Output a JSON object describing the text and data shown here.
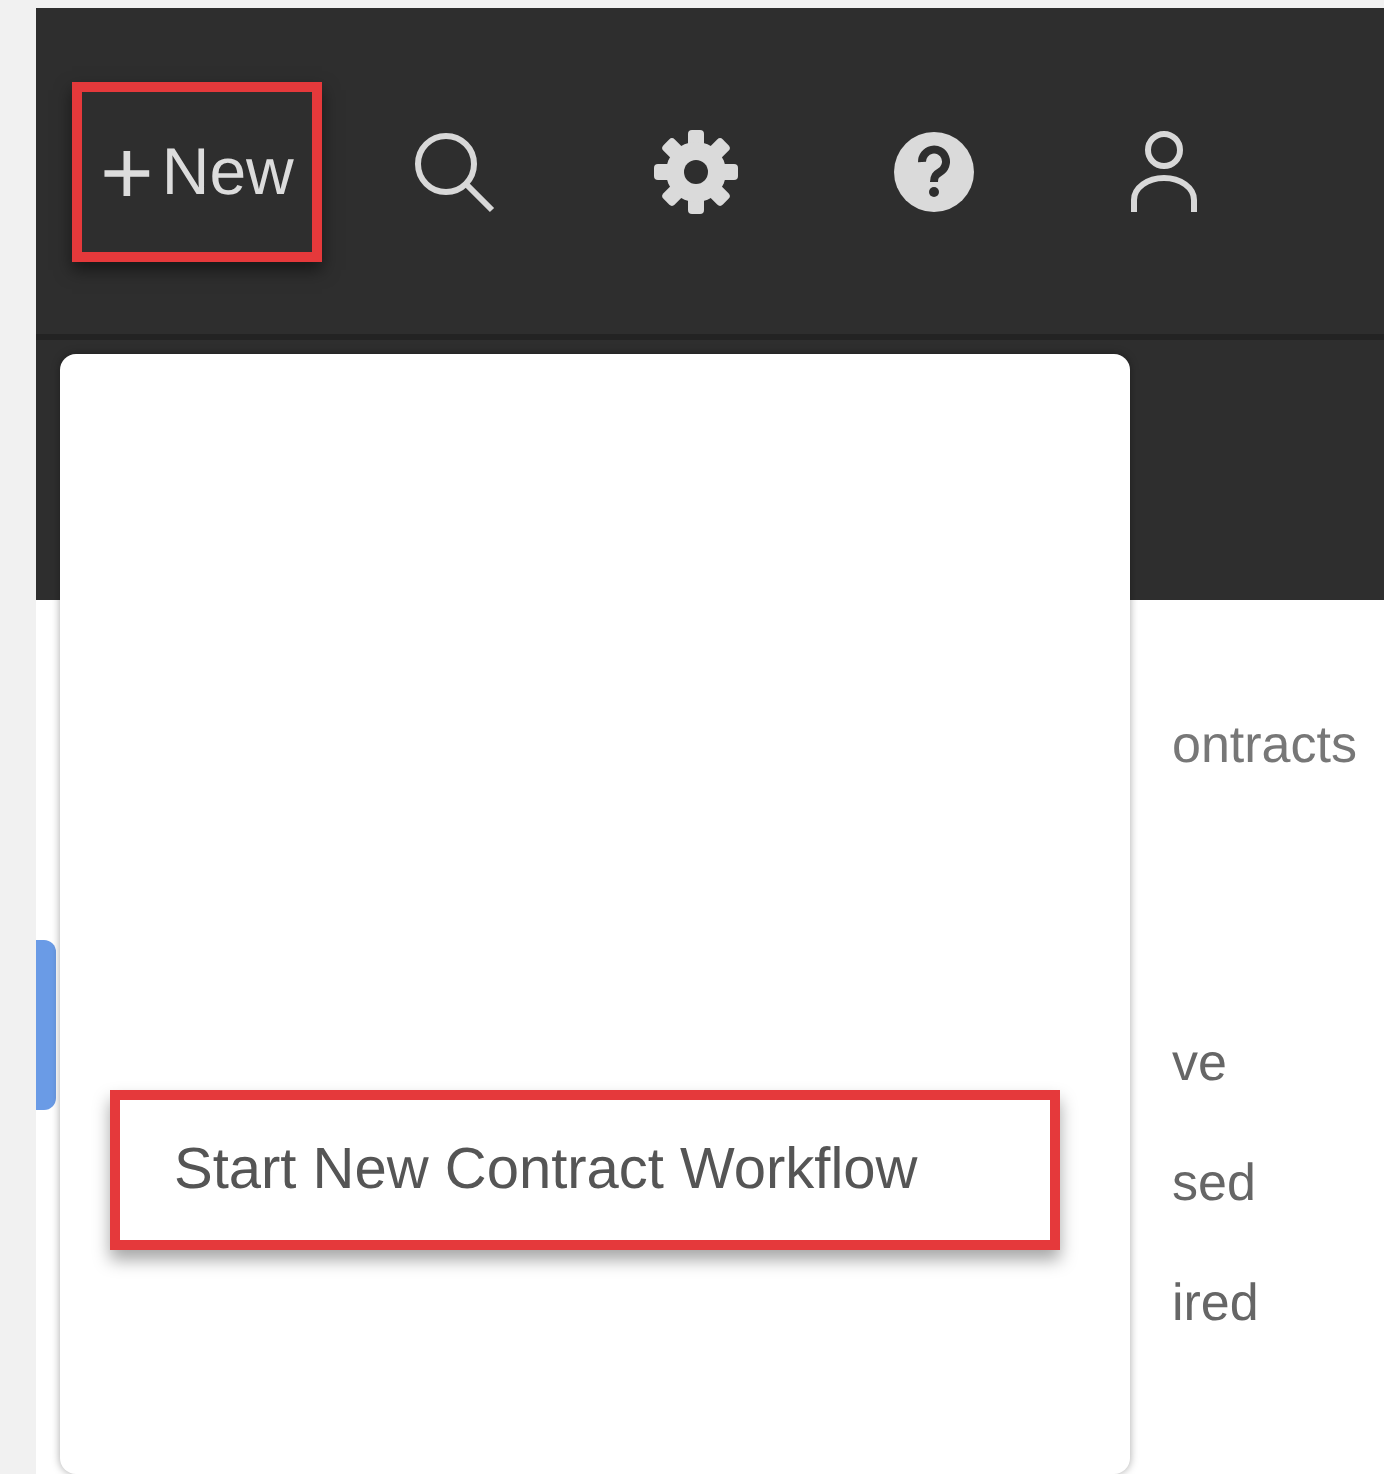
{
  "header": {
    "new_button": {
      "icon": "+",
      "label": "New",
      "highlighted": true
    }
  },
  "menu": {
    "items": [
      {
        "label": "Start New Contract Workflow",
        "highlighted": true
      }
    ]
  },
  "content": {
    "title": "ontracts",
    "items": [
      "ve",
      "sed",
      "ired"
    ]
  }
}
